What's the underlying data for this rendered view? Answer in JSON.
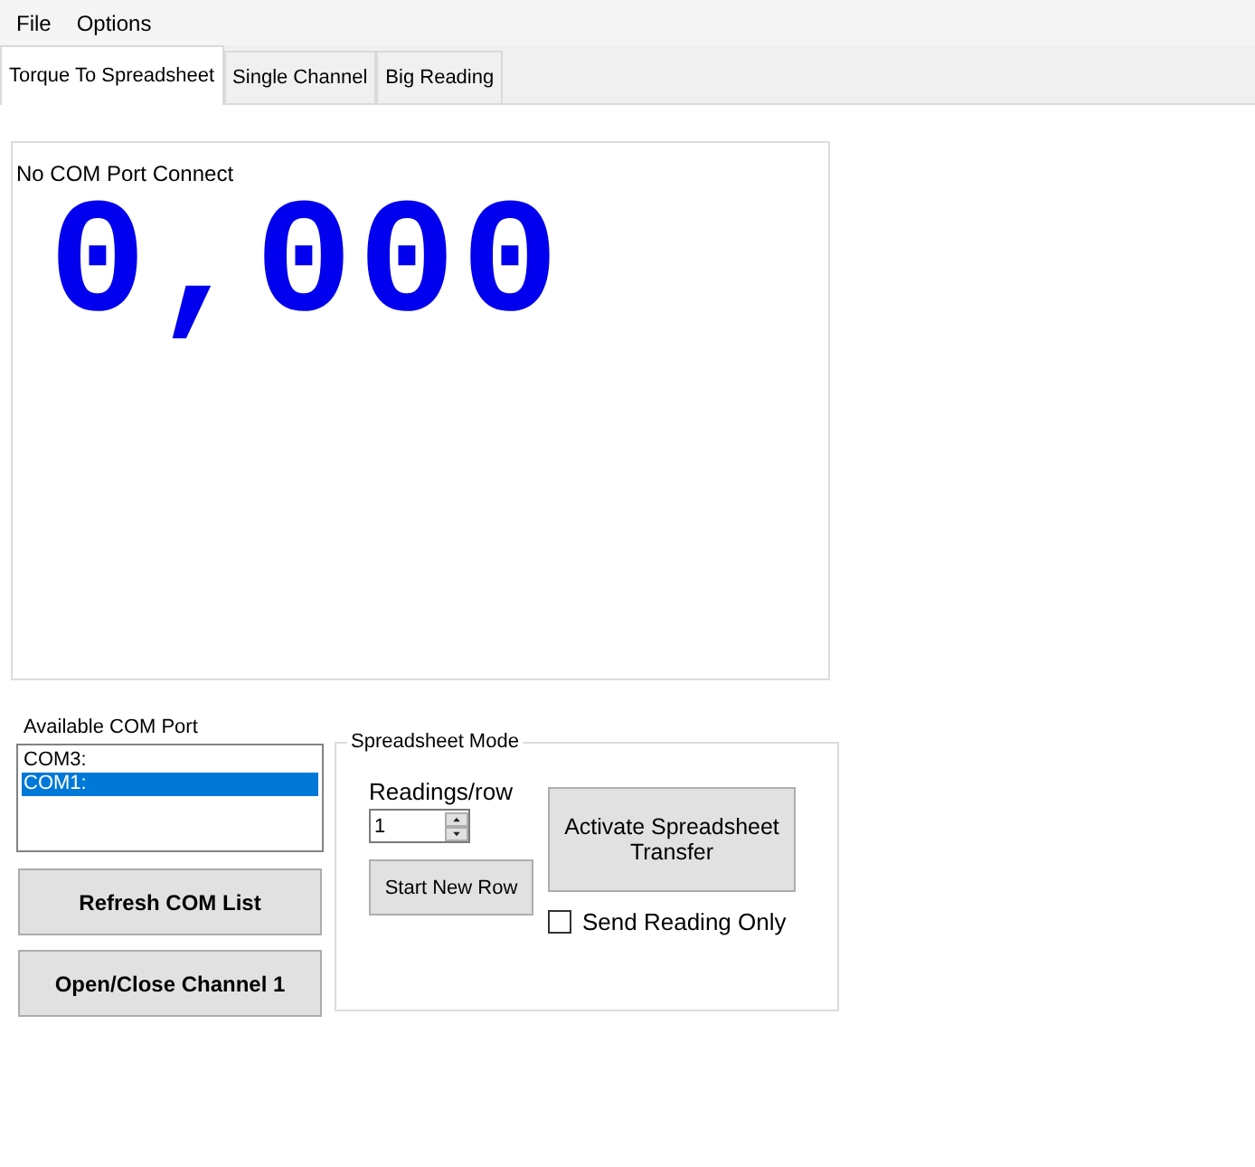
{
  "menu": [
    "File",
    "Options"
  ],
  "tabs": [
    {
      "label": "Torque To Spreadsheet",
      "selected": true
    },
    {
      "label": "Single Channel",
      "selected": false
    },
    {
      "label": "Big Reading",
      "selected": false
    }
  ],
  "reading_panel": {
    "status": "No COM Port Connect",
    "reading": "0,000"
  },
  "com_ports": {
    "label": "Available COM Port",
    "items": [
      {
        "label": "COM3:",
        "selected": false
      },
      {
        "label": "COM1:",
        "selected": true
      }
    ]
  },
  "buttons": [
    "Refresh COM List",
    "Open/Close Channel 1"
  ],
  "spreadsheet_mode": {
    "title": "Spreadsheet Mode",
    "readings_label": "Readings/row",
    "readings_value": "1",
    "start_button": "Start New Row",
    "activate_button": "Activate Spreadsheet Transfer",
    "send_reading_only": {
      "label": "Send Reading Only",
      "checked": false
    }
  }
}
